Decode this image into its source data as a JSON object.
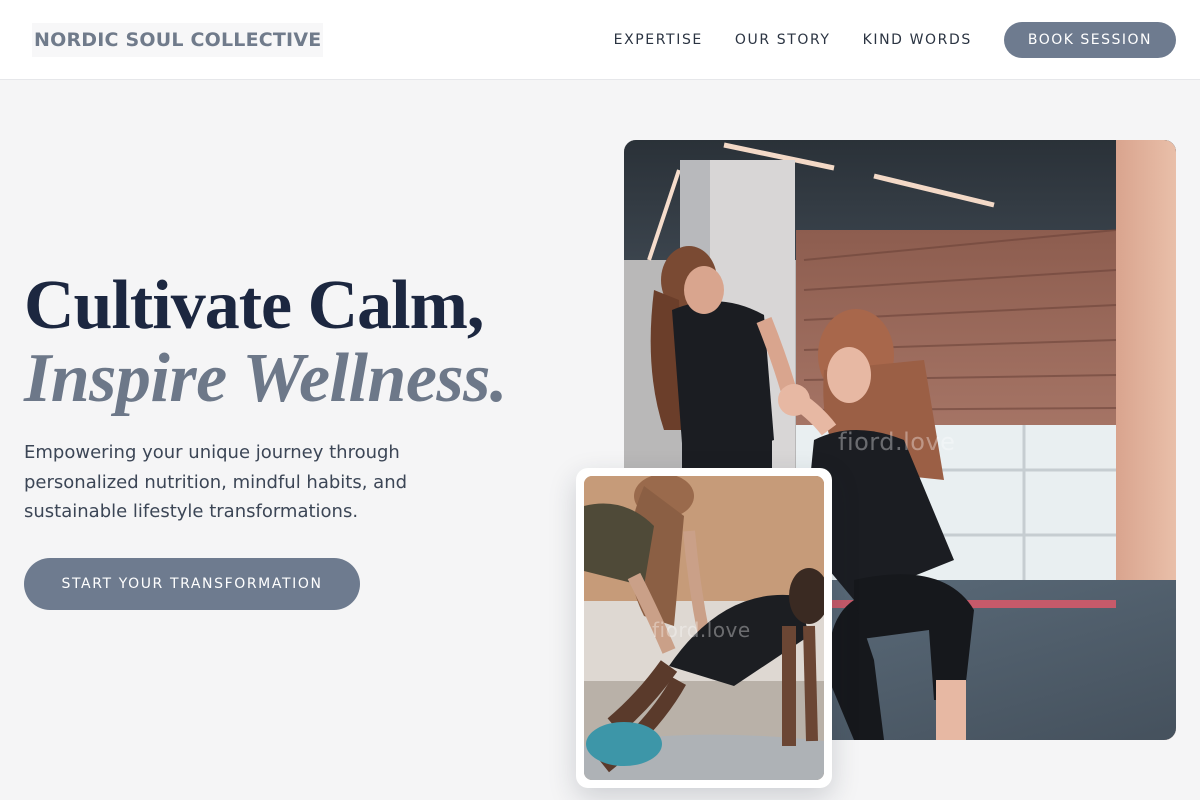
{
  "header": {
    "brand": "NORDIC SOUL COLLECTIVE",
    "nav": [
      {
        "label": "EXPERTISE"
      },
      {
        "label": "OUR STORY"
      },
      {
        "label": "KIND WORDS"
      }
    ],
    "book_label": "BOOK SESSION"
  },
  "hero": {
    "title_line1": "Cultivate Calm,",
    "title_line2": "Inspire Wellness.",
    "subtitle": "Empowering your unique journey through personalized nutrition, mindful habits, and sustainable lifestyle transformations.",
    "cta_label": "START YOUR TRANSFORMATION"
  },
  "images": {
    "main_watermark": "fiord.love",
    "small_watermark": "fiord.love"
  },
  "colors": {
    "accent": "#6e7b8f",
    "heading": "#1c2740",
    "italic_heading": "#6d7889",
    "background": "#f5f5f6"
  }
}
